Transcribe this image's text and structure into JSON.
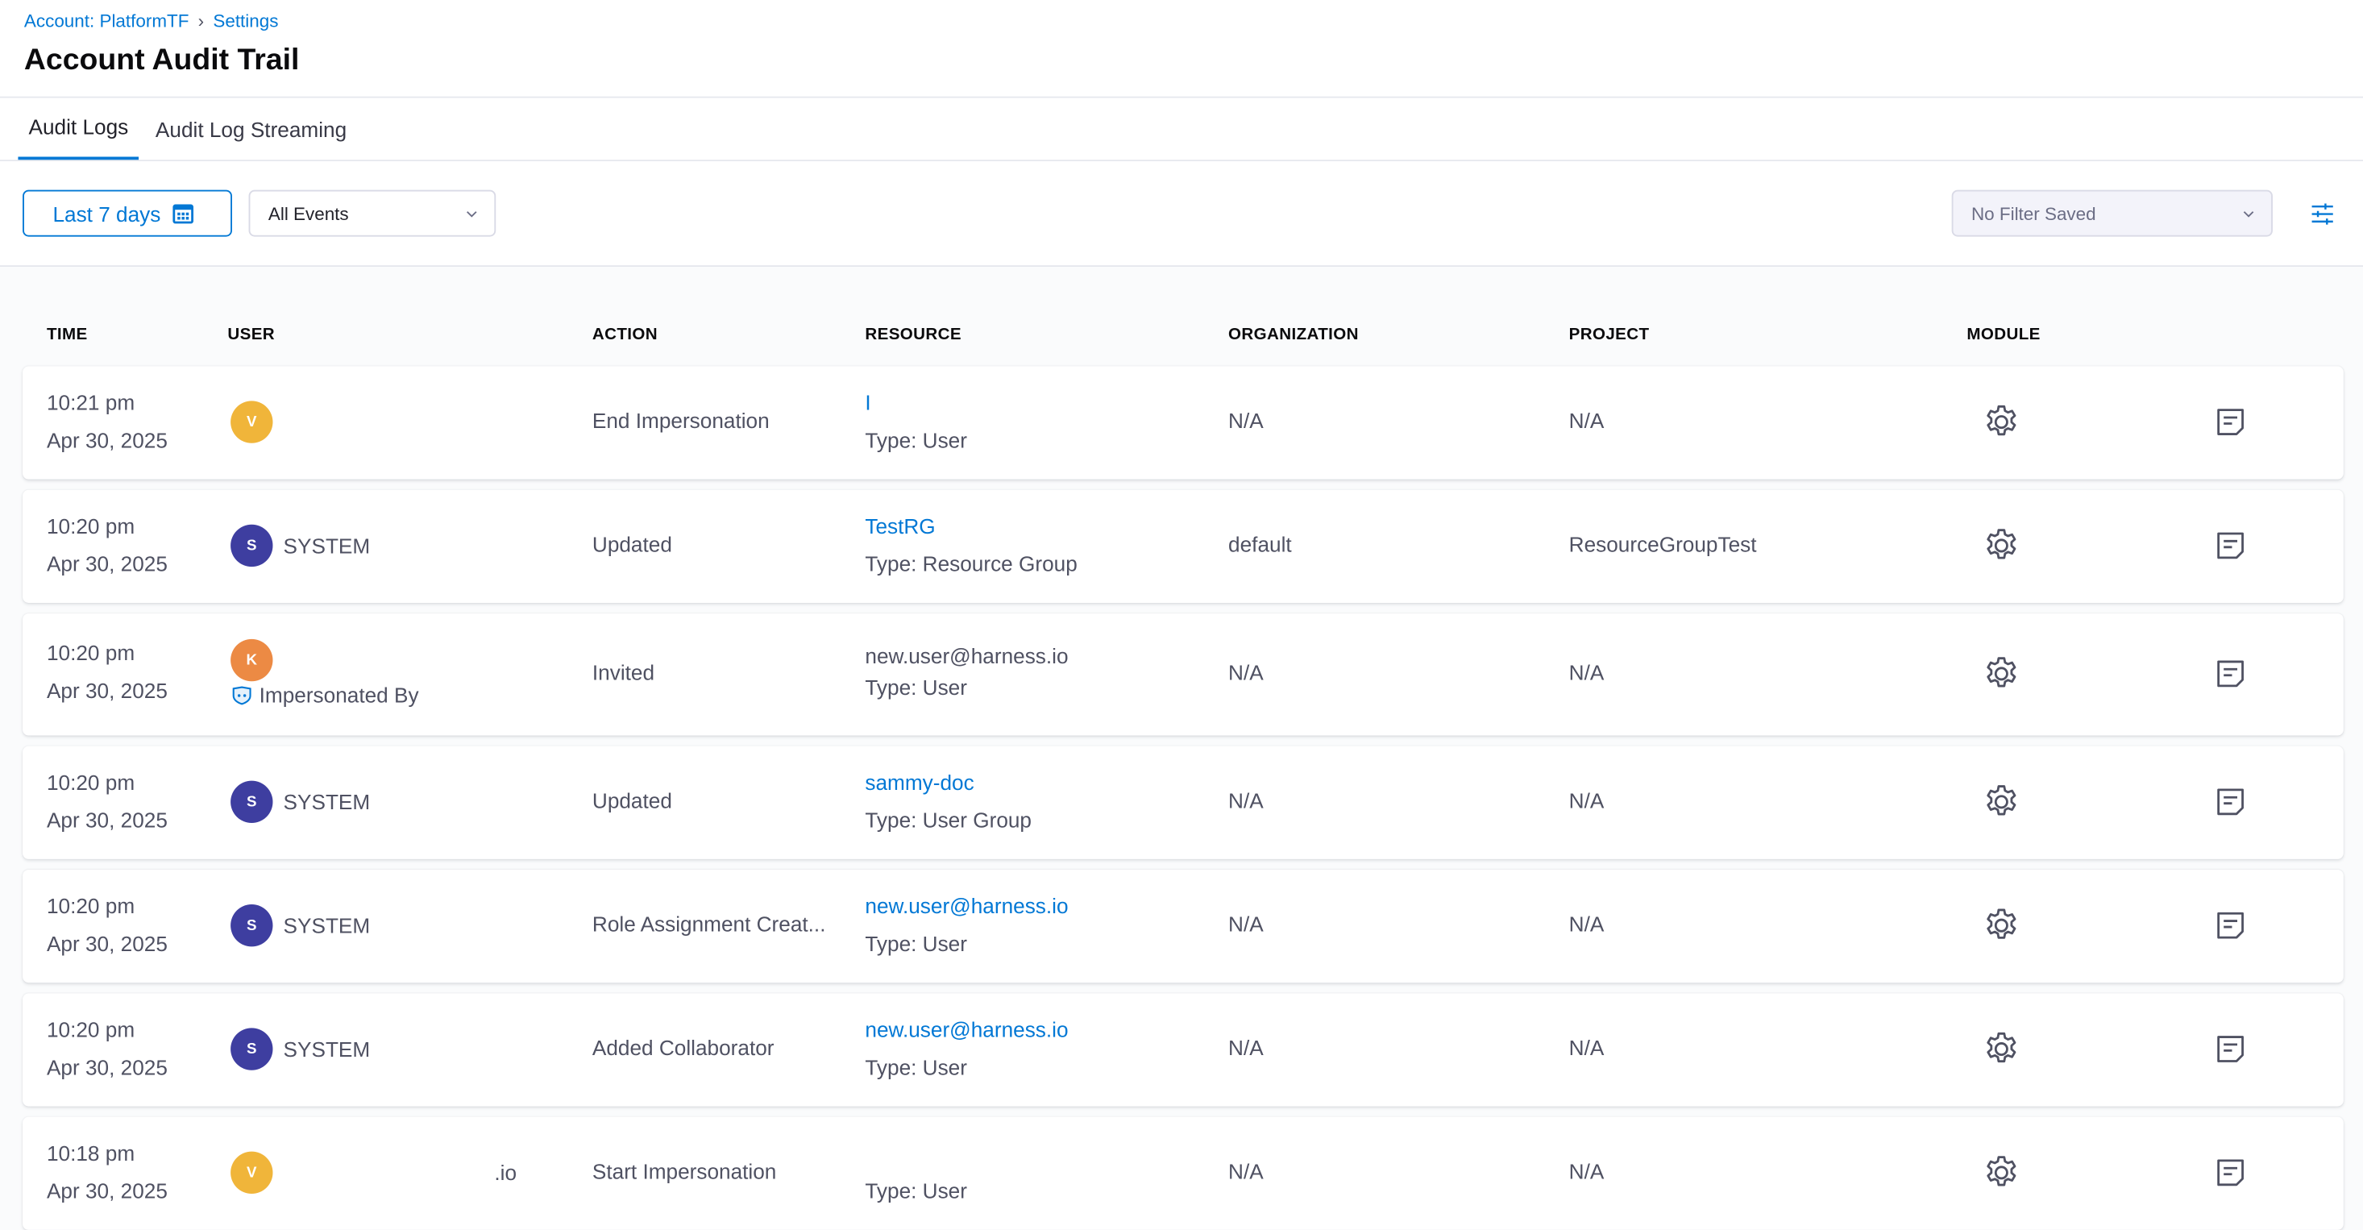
{
  "breadcrumb": {
    "account": "Account: PlatformTF",
    "separator": "›",
    "settings": "Settings"
  },
  "page": {
    "title": "Account Audit Trail"
  },
  "tabs": [
    {
      "label": "Audit Logs",
      "active": true
    },
    {
      "label": "Audit Log Streaming",
      "active": false
    }
  ],
  "toolbar": {
    "date_label": "Last 7 days",
    "events_select": "All Events",
    "filter_select": "No Filter Saved"
  },
  "columns": [
    "TIME",
    "USER",
    "ACTION",
    "RESOURCE",
    "ORGANIZATION",
    "PROJECT",
    "MODULE"
  ],
  "rows": [
    {
      "time": "10:21 pm",
      "date": "Apr 30, 2025",
      "avatar": "V",
      "user": "",
      "action": "End Impersonation",
      "resource": "I",
      "resource_type": "Type: User",
      "org": "N/A",
      "project": "N/A",
      "module_icon": "gear-icon"
    },
    {
      "time": "10:20 pm",
      "date": "Apr 30, 2025",
      "avatar": "S",
      "user": "SYSTEM",
      "action": "Updated",
      "resource": "TestRG",
      "resource_type": "Type: Resource Group",
      "org": "default",
      "project": "ResourceGroupTest",
      "module_icon": "gear-icon"
    },
    {
      "time": "10:20 pm",
      "date": "Apr 30, 2025",
      "avatar": "K",
      "user": "",
      "impersonated_label": "Impersonated By",
      "action": "Invited",
      "resource": "new.user@harness.io",
      "resource_type": "Type: User",
      "org": "N/A",
      "project": "N/A",
      "module_icon": "gear-icon"
    },
    {
      "time": "10:20 pm",
      "date": "Apr 30, 2025",
      "avatar": "S",
      "user": "SYSTEM",
      "action": "Updated",
      "resource": "sammy-doc",
      "resource_type": "Type: User Group",
      "org": "N/A",
      "project": "N/A",
      "module_icon": "gear-icon"
    },
    {
      "time": "10:20 pm",
      "date": "Apr 30, 2025",
      "avatar": "S",
      "user": "SYSTEM",
      "action": "Role Assignment Creat...",
      "resource": "new.user@harness.io",
      "resource_type": "Type: User",
      "org": "N/A",
      "project": "N/A",
      "module_icon": "gear-icon"
    },
    {
      "time": "10:20 pm",
      "date": "Apr 30, 2025",
      "avatar": "S",
      "user": "SYSTEM",
      "action": "Added Collaborator",
      "resource": "new.user@harness.io",
      "resource_type": "Type: User",
      "org": "N/A",
      "project": "N/A",
      "module_icon": "gear-icon"
    },
    {
      "time": "10:18 pm",
      "date": "Apr 30, 2025",
      "avatar": "V",
      "user": ".io",
      "action": "Start Impersonation",
      "resource": "",
      "resource_type": "Type: User",
      "org": "N/A",
      "project": "N/A",
      "module_icon": "gear-icon"
    }
  ],
  "colors": {
    "accent": "#0278d5",
    "system_avatar": "#3e3ea0",
    "v_avatar": "#f0b53a",
    "k_avatar": "#ec8a44"
  }
}
